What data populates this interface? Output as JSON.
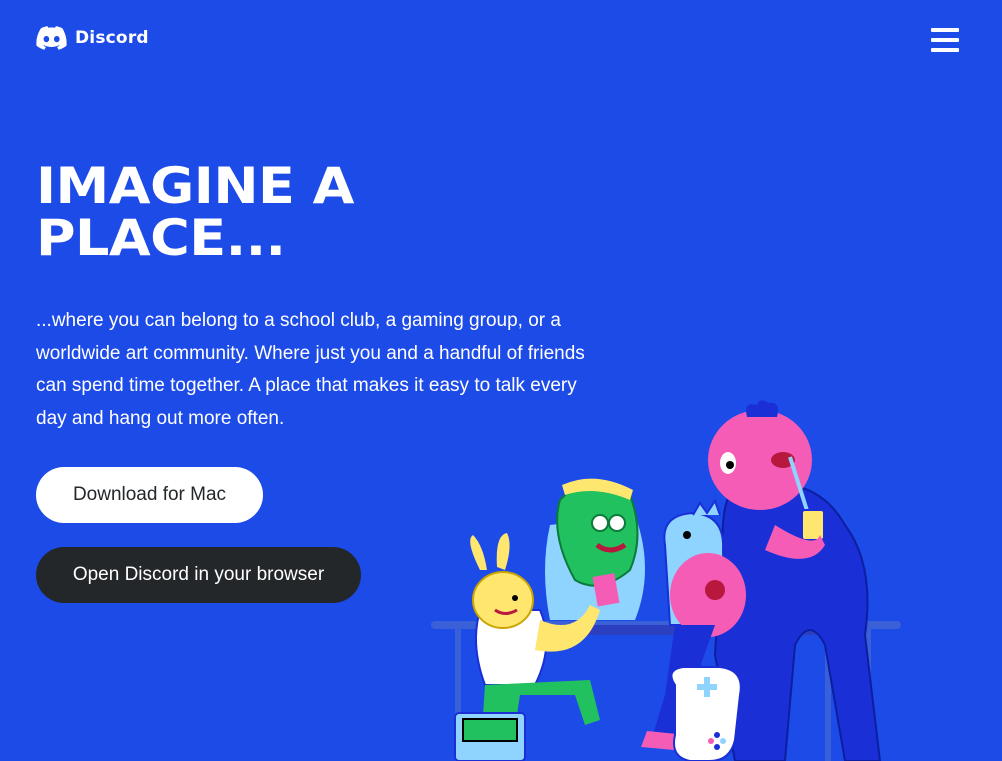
{
  "header": {
    "brand": "Discord",
    "logo_icon": "discord-clyde-icon",
    "menu_icon": "hamburger-menu-icon"
  },
  "hero": {
    "title_line1": "IMAGINE A",
    "title_line2": "PLACE...",
    "description": "...where you can belong to a school club, a gaming group, or a worldwide art community. Where just you and a handful of friends can spend time together. A place that makes it easy to talk every day and hang out more often."
  },
  "actions": {
    "download_label": "Download for Mac",
    "browser_label": "Open Discord in your browser"
  },
  "colors": {
    "background": "#1D4BE8",
    "download_bg": "#FFFFFF",
    "browser_bg": "#23272A"
  }
}
